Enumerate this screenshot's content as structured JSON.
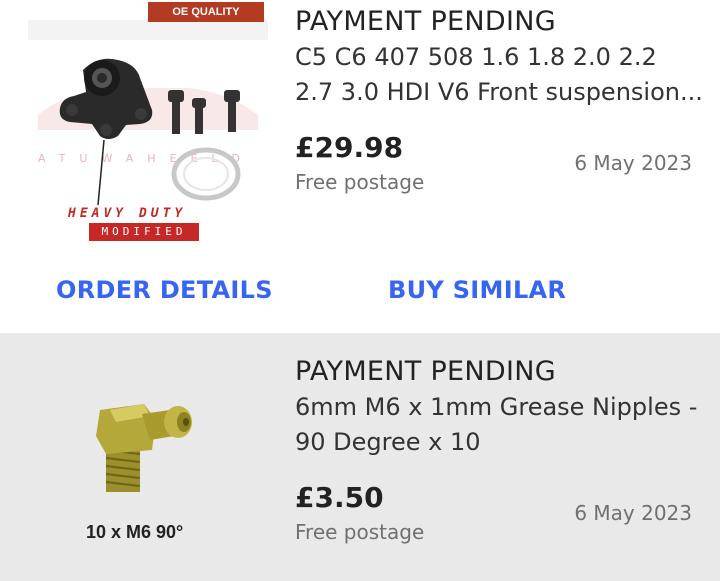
{
  "orders": [
    {
      "status": "PAYMENT PENDING",
      "title_line1": "C5 C6 407 508 1.6 1.8 2.0 2.2",
      "title_line2": "2.7 3.0 HDI V6 Front suspension...",
      "price": "£29.98",
      "postage": "Free postage",
      "date": "6 May 2023",
      "image": {
        "badge": "OE QUALITY",
        "heavy": "HEAVY DUTY",
        "modified": "MODIFIED"
      },
      "actions": {
        "order_details": "ORDER DETAILS",
        "buy_similar": "BUY SIMILAR"
      }
    },
    {
      "status": "PAYMENT PENDING",
      "title_line1": "6mm M6 x 1mm Grease Nipples -",
      "title_line2": "90 Degree x 10",
      "price": "£3.50",
      "postage": "Free postage",
      "date": "6 May 2023",
      "image": {
        "caption": "10 x M6 90°"
      }
    }
  ],
  "colors": {
    "link": "#3665f3",
    "card2_bg": "#e9e9e9",
    "muted_text": "#707070"
  }
}
